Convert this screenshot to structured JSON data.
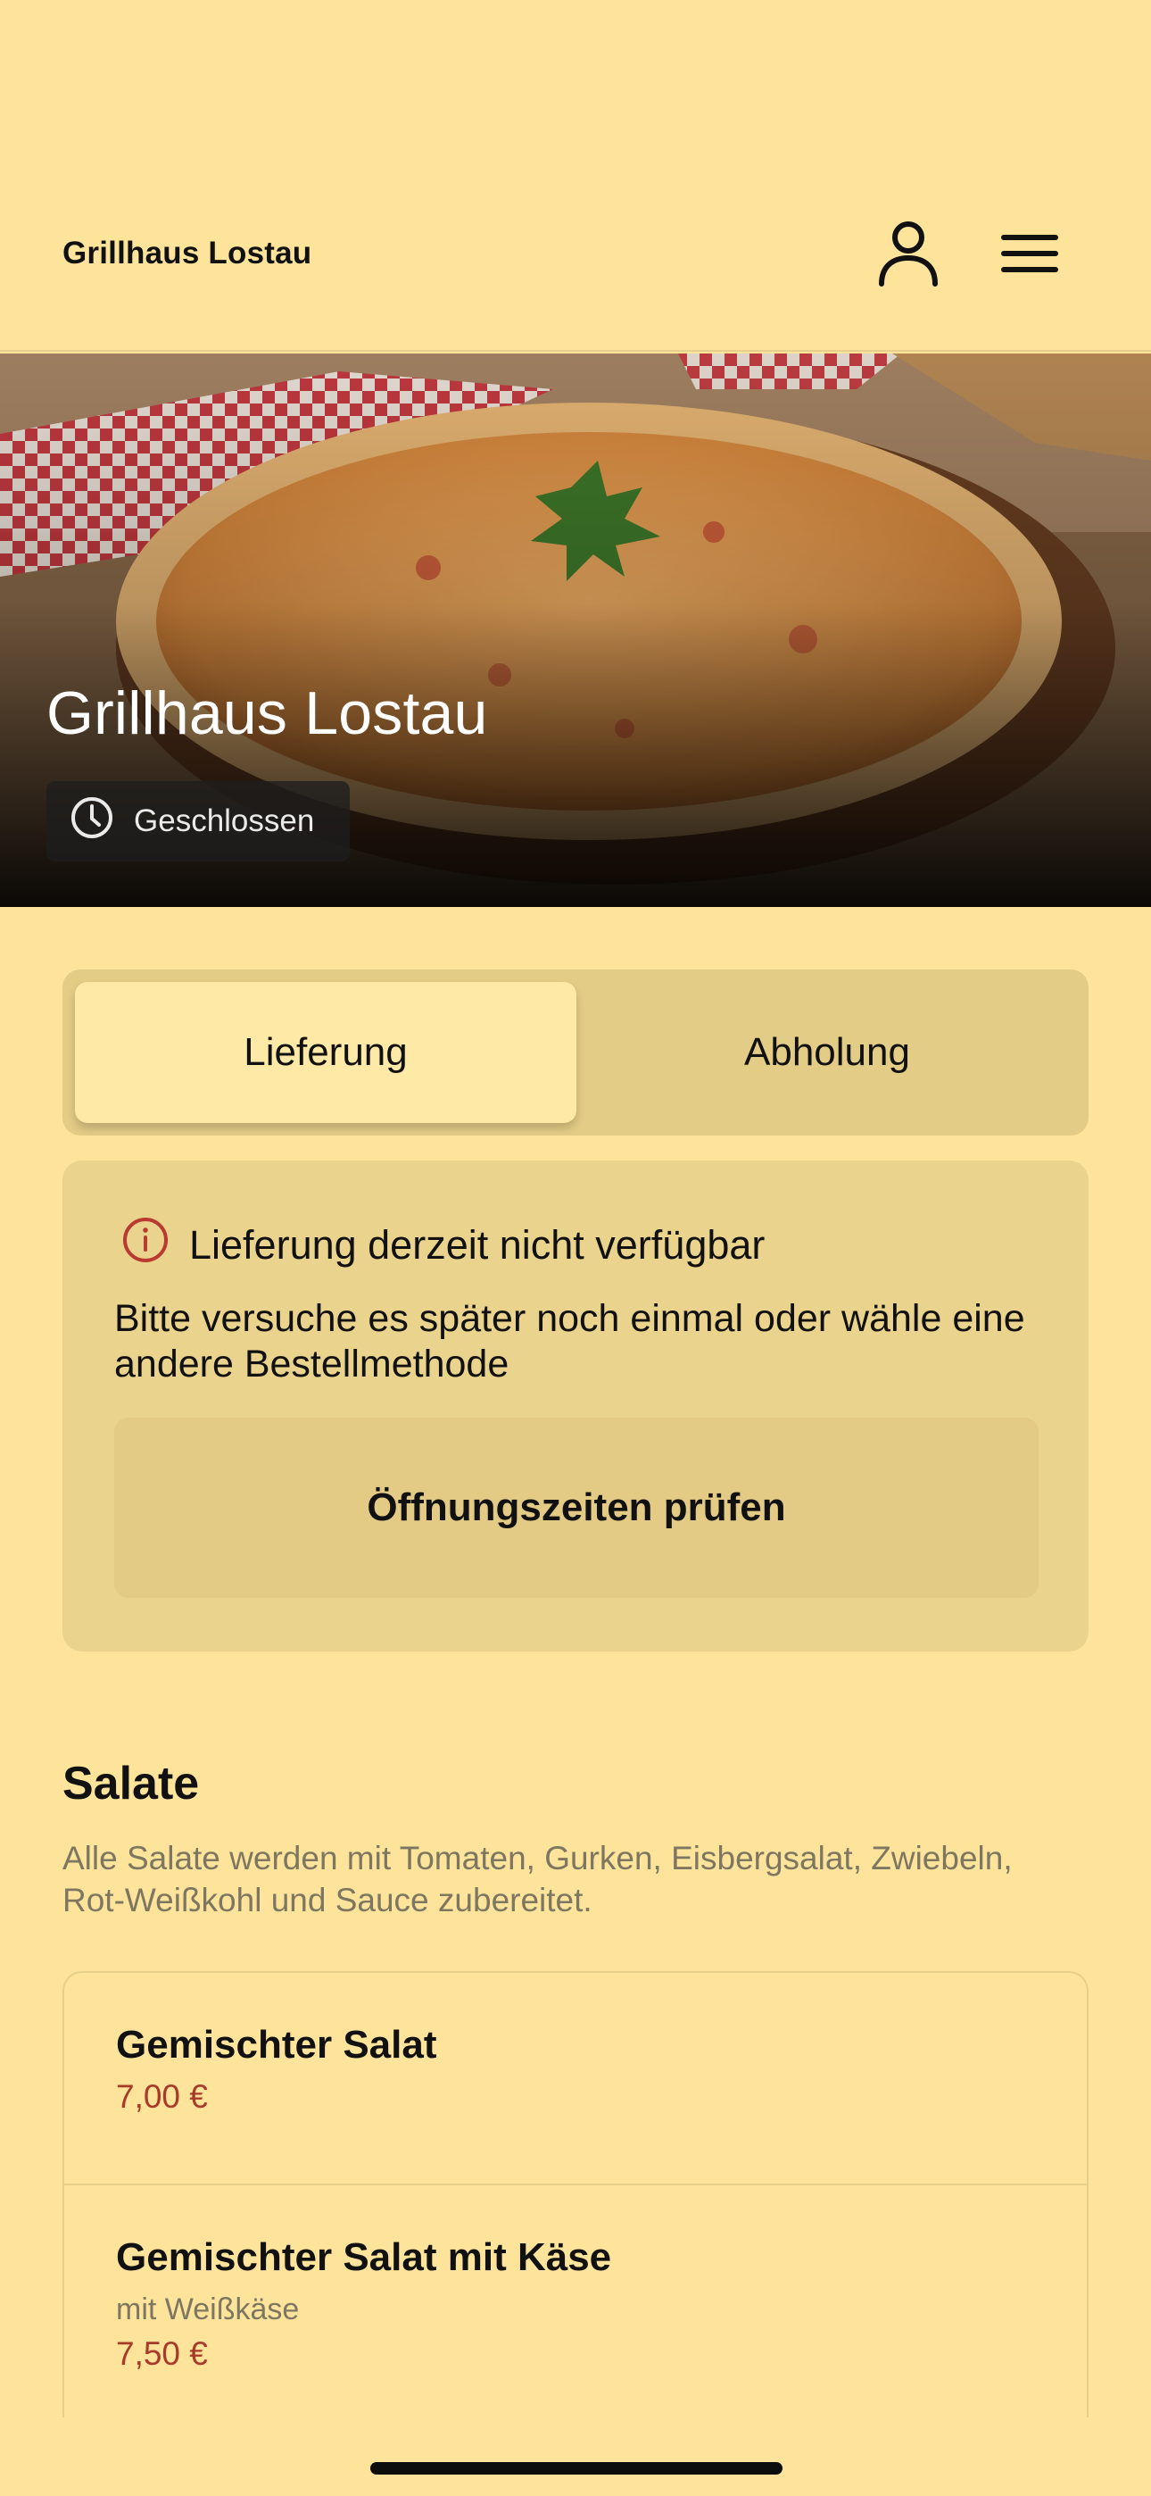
{
  "header": {
    "title": "Grillhaus Lostau",
    "profile_icon": "user-icon",
    "menu_icon": "hamburger-menu-icon"
  },
  "hero": {
    "restaurant_name": "Grillhaus Lostau",
    "status_icon": "clock-icon",
    "status_label": "Geschlossen"
  },
  "order_mode": {
    "options": [
      "Lieferung",
      "Abholung"
    ],
    "selected": "Lieferung"
  },
  "notice": {
    "icon": "info-icon",
    "title": "Lieferung derzeit nicht verfügbar",
    "body": "Bitte versuche es später noch einmal oder wähle eine andere Bestellmethode",
    "button_label": "Öffnungszeiten prüfen"
  },
  "menu": {
    "section_title": "Salate",
    "section_description": "Alle Salate werden mit Tomaten, Gurken, Eisbergsalat, Zwiebeln, Rot-Weißkohl und Sauce zubereitet.",
    "items": [
      {
        "name": "Gemischter Salat",
        "description": "",
        "price": "7,00 €"
      },
      {
        "name": "Gemischter Salat mit Käse",
        "description": "mit Weißkäse",
        "price": "7,50 €"
      }
    ]
  },
  "colors": {
    "background": "#FEE49B",
    "segment_track": "#E3CC86",
    "segment_active": "#FEE9A6",
    "notice_bg": "#EAD38D",
    "price": "#A83A2A",
    "info_icon": "#B83A30"
  }
}
